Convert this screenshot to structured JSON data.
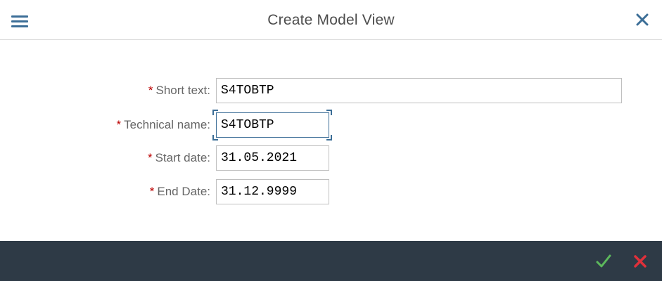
{
  "dialog": {
    "title": "Create Model View",
    "menu_icon": "hamburger-menu-icon",
    "close_icon": "close-icon"
  },
  "form": {
    "fields": [
      {
        "label": "Short text:",
        "required_marker": "*",
        "value": "S4TOBTP"
      },
      {
        "label": "Technical name:",
        "required_marker": "*",
        "value": "S4TOBTP"
      },
      {
        "label": "Start date:",
        "required_marker": "*",
        "value": "31.05.2021"
      },
      {
        "label": "End Date:",
        "required_marker": "*",
        "value": "31.12.9999"
      }
    ]
  },
  "footer": {
    "confirm_icon": "checkmark-icon",
    "cancel_icon": "cancel-x-icon"
  },
  "colors": {
    "accent": "#3c6e97",
    "required": "#bb0000",
    "footer_bg": "#2e3a46",
    "confirm": "#5cb85c",
    "cancel": "#e0303a"
  }
}
